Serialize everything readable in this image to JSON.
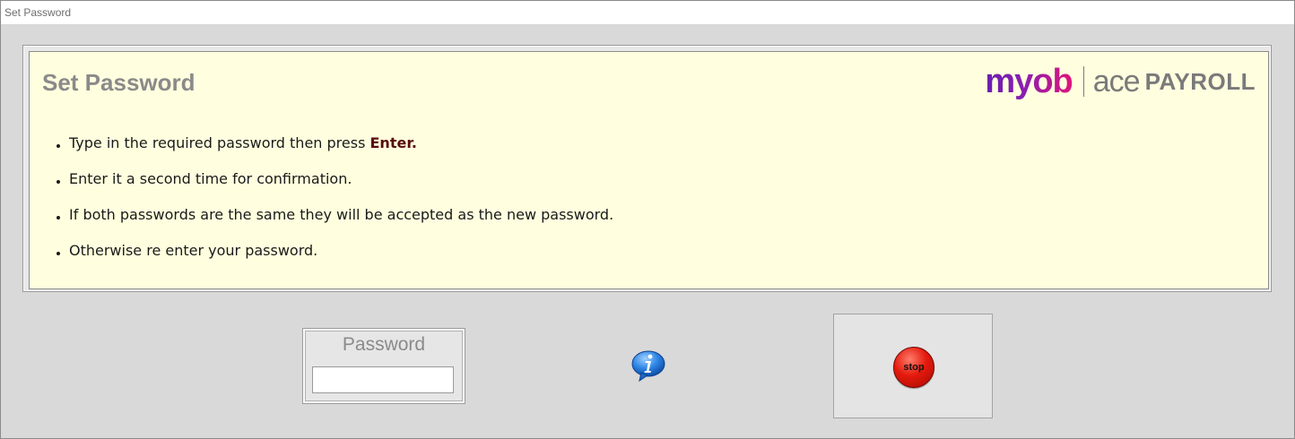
{
  "window": {
    "title": "Set Password"
  },
  "panel": {
    "title": "Set Password",
    "logo": {
      "brand": "myob",
      "product_light": "ace",
      "product_bold": "PAYROLL"
    },
    "bullets": [
      {
        "text": "Type in the required password then press ",
        "emphasis": "Enter."
      },
      {
        "text": "Enter it a second time for confirmation."
      },
      {
        "text": "If both passwords are the same they will be accepted as the new password."
      },
      {
        "text": "Otherwise re enter your password."
      }
    ]
  },
  "password": {
    "label": "Password",
    "value": ""
  },
  "info": {
    "icon": "info-icon"
  },
  "stop": {
    "label": "stop"
  },
  "colors": {
    "panel_bg": "#ffffdf",
    "window_bg": "#d9d9d9",
    "title_gray": "#8a8a8a",
    "enter_emphasis": "#5a0b0b",
    "stop_red": "#e41a0d",
    "logo_purple": "#6a1eae",
    "logo_pink": "#e0157a"
  }
}
